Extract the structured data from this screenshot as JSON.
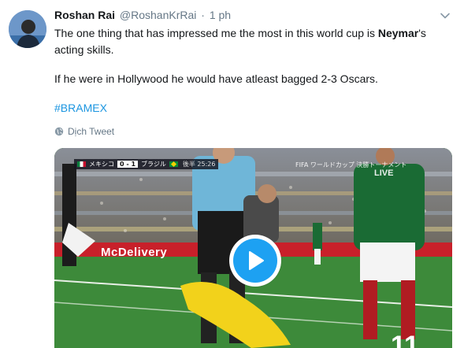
{
  "tweet": {
    "author_name": "Roshan Rai",
    "author_handle": "@RoshanKrRai",
    "separator": "·",
    "time": "1 ph",
    "text_line1_pre": "The one thing that has impressed me the most in this world cup is ",
    "text_line1_bold": "Neymar",
    "text_line1_post": "'s acting skills.",
    "text_line2": "If he were in Hollywood he would have atleast bagged 2-3 Oscars.",
    "hashtag": "#BRAMEX",
    "translate_label": "Dịch Tweet",
    "icons": {
      "menu": "chevron-down-icon",
      "translate": "globe-icon",
      "play": "play-icon"
    },
    "colors": {
      "link": "#1b95e0",
      "play_button": "#1da1f2",
      "secondary_text": "#657786"
    }
  },
  "video": {
    "score_team1": "メキシコ",
    "score": "0 - 1",
    "score_team2": "ブラジル",
    "clock": "後半 25:26",
    "broadcast_text": "FIFA ワールドカップ 決勝トーナメント",
    "live_label": "LIVE",
    "sponsor_text": "McDelivery",
    "jersey_number": "11"
  }
}
